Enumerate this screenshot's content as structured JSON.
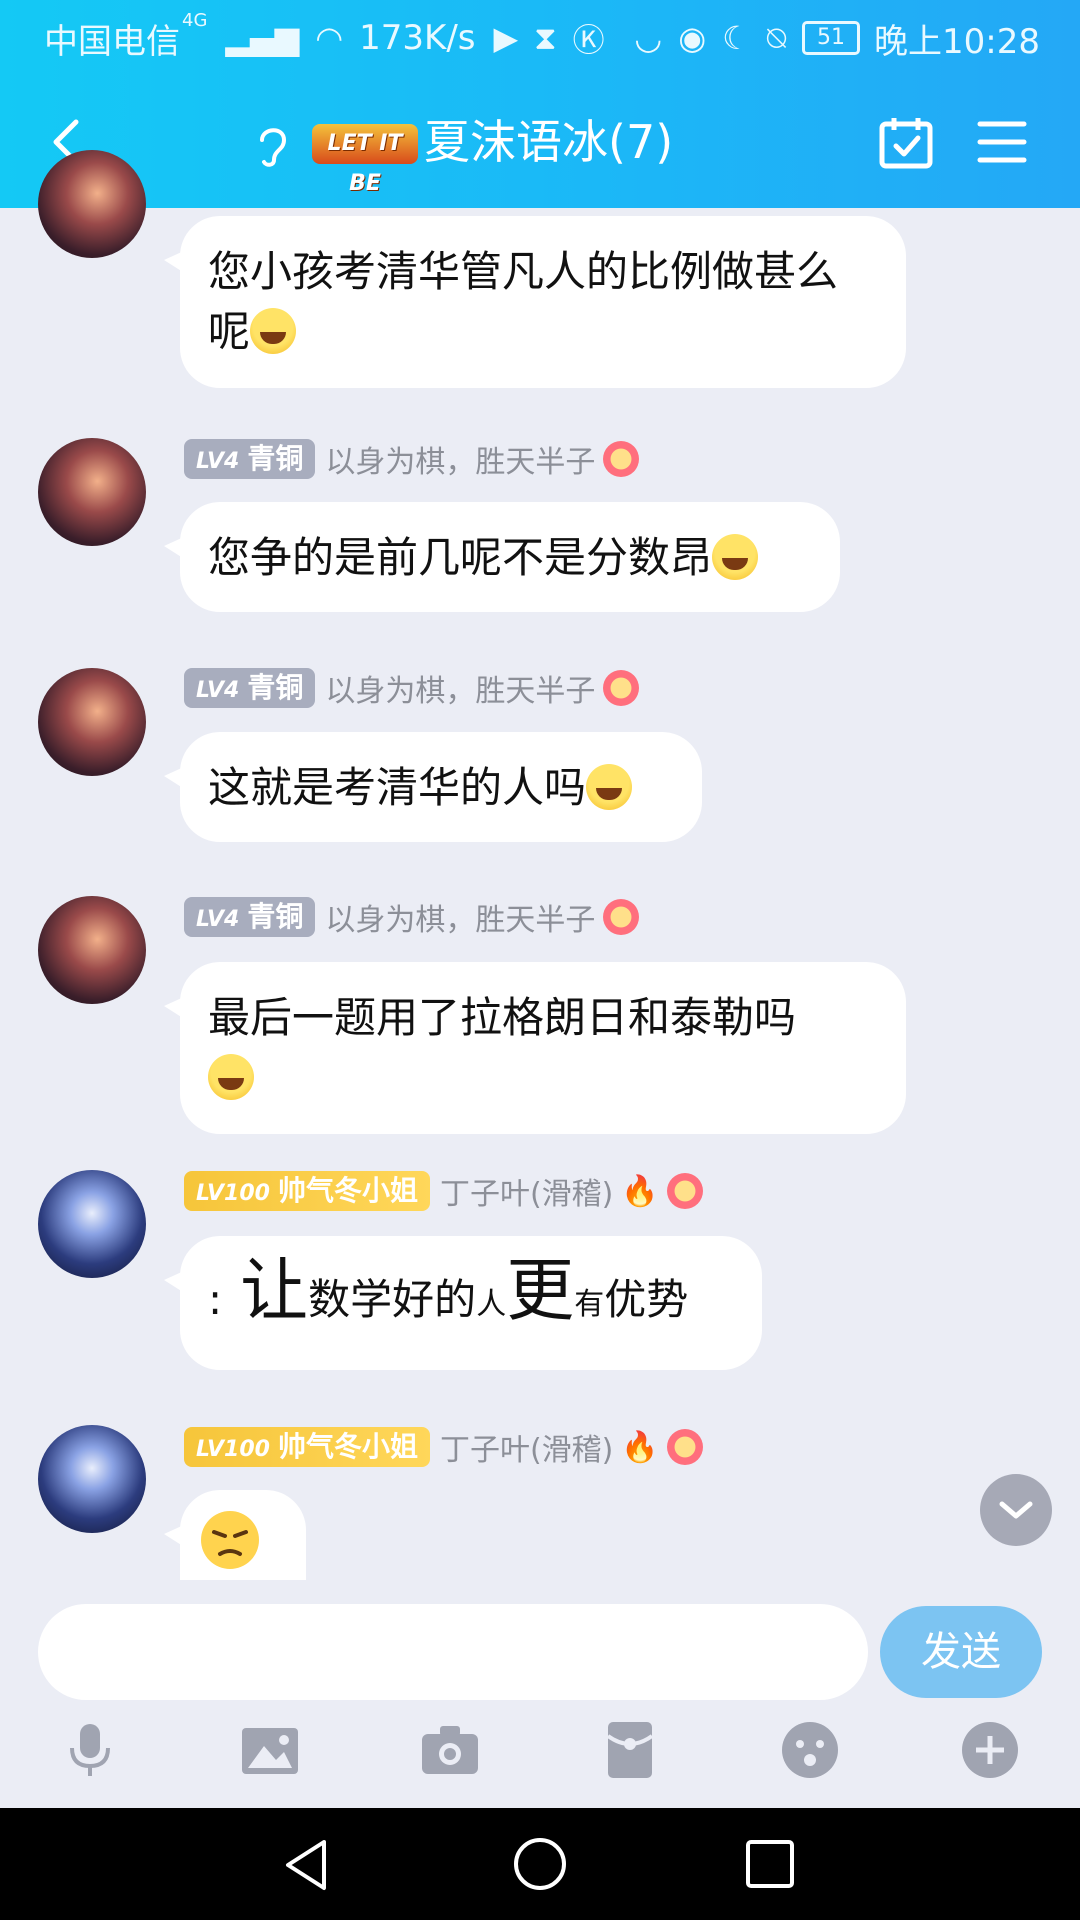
{
  "status_bar": {
    "carrier": "中国电信",
    "network": "4G",
    "speed": "173K/s",
    "battery": "51",
    "time": "晚上10:28"
  },
  "header": {
    "logo_text": "LET IT BE",
    "title": "夏沫语冰(7)"
  },
  "messages": [
    {
      "text": "您小孩考清华管凡人的比例做甚么呢"
    },
    {
      "level": "LV4",
      "rank": "青铜",
      "nickname": "以身为棋，胜天半子",
      "text": "您争的是前几呢不是分数昂"
    },
    {
      "level": "LV4",
      "rank": "青铜",
      "nickname": "以身为棋，胜天半子",
      "text": "这就是考清华的人吗"
    },
    {
      "level": "LV4",
      "rank": "青铜",
      "nickname": "以身为棋，胜天半子",
      "text": "最后一题用了拉格朗日和泰勒吗"
    },
    {
      "level": "LV100",
      "rank": "帅气冬小姐",
      "nickname": "丁子叶(滑稽)",
      "text_parts": [
        ":",
        "让",
        "数学好的",
        "人",
        "更",
        "有",
        "优势"
      ]
    },
    {
      "level": "LV100",
      "rank": "帅气冬小姐",
      "nickname": "丁子叶(滑稽)",
      "sticker": "annoyed-face"
    }
  ],
  "input": {
    "placeholder": "",
    "send_label": "发送"
  },
  "colors": {
    "header": "#1bb8f7",
    "background": "#ebedf5",
    "send": "#7cc4f2",
    "badge_bronze": "#a8adbe",
    "badge_gold": "#f6c53a"
  }
}
